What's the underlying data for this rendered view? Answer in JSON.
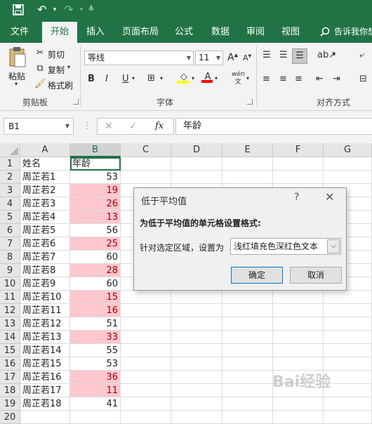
{
  "quick_access": {
    "save_icon": "save-icon",
    "undo_icon": "undo-icon",
    "redo_icon": "redo-icon",
    "customize_icon": "customize-icon"
  },
  "tabs": [
    "文件",
    "开始",
    "插入",
    "页面布局",
    "公式",
    "数据",
    "审阅",
    "视图"
  ],
  "active_tab": "开始",
  "tell_me": "告诉我你想",
  "ribbon": {
    "clipboard": {
      "paste": "粘贴",
      "cut": "剪切",
      "copy": "复制",
      "format_painter": "格式刷",
      "label": "剪贴板"
    },
    "font": {
      "name": "等线",
      "size": "11",
      "bold": "B",
      "italic": "I",
      "underline": "U",
      "grow": "A",
      "shrink": "A",
      "phonetic": "wén",
      "label": "字体"
    },
    "alignment": {
      "label": "对齐方式"
    }
  },
  "formula_bar": {
    "name_box": "B1",
    "cancel": "✕",
    "enter": "✓",
    "fx": "fx",
    "formula": "年龄"
  },
  "columns": [
    "A",
    "B",
    "C",
    "D",
    "E",
    "F",
    "G"
  ],
  "rows": [
    {
      "num": "1",
      "a": "姓名",
      "b": "年龄",
      "low": false
    },
    {
      "num": "2",
      "a": "周芷若1",
      "b": "53",
      "low": false
    },
    {
      "num": "3",
      "a": "周芷若2",
      "b": "19",
      "low": true
    },
    {
      "num": "4",
      "a": "周芷若3",
      "b": "26",
      "low": true
    },
    {
      "num": "5",
      "a": "周芷若4",
      "b": "13",
      "low": true
    },
    {
      "num": "6",
      "a": "周芷若5",
      "b": "56",
      "low": false
    },
    {
      "num": "7",
      "a": "周芷若6",
      "b": "25",
      "low": true
    },
    {
      "num": "8",
      "a": "周芷若7",
      "b": "60",
      "low": false
    },
    {
      "num": "9",
      "a": "周芷若8",
      "b": "28",
      "low": true
    },
    {
      "num": "10",
      "a": "周芷若9",
      "b": "60",
      "low": false
    },
    {
      "num": "11",
      "a": "周芷若10",
      "b": "15",
      "low": true
    },
    {
      "num": "12",
      "a": "周芷若11",
      "b": "16",
      "low": true
    },
    {
      "num": "13",
      "a": "周芷若12",
      "b": "51",
      "low": false
    },
    {
      "num": "14",
      "a": "周芷若13",
      "b": "33",
      "low": true
    },
    {
      "num": "15",
      "a": "周芷若14",
      "b": "55",
      "low": false
    },
    {
      "num": "16",
      "a": "周芷若15",
      "b": "53",
      "low": false
    },
    {
      "num": "17",
      "a": "周芷若16",
      "b": "36",
      "low": true
    },
    {
      "num": "18",
      "a": "周芷若17",
      "b": "11",
      "low": true
    },
    {
      "num": "19",
      "a": "周芷若18",
      "b": "41",
      "low": false
    },
    {
      "num": "20",
      "a": "",
      "b": "",
      "low": false
    }
  ],
  "dialog": {
    "title": "低于平均值",
    "help": "?",
    "close": "✕",
    "heading": "为低于平均值的单元格设置格式:",
    "label": "针对选定区域，设置为",
    "selected": "浅红填充色深红色文本",
    "ok": "确定",
    "cancel": "取消"
  },
  "colors": {
    "excel_green": "#217346",
    "low_fill": "#ffc7ce",
    "low_text": "#9c0006"
  },
  "watermark": "Bai经验"
}
